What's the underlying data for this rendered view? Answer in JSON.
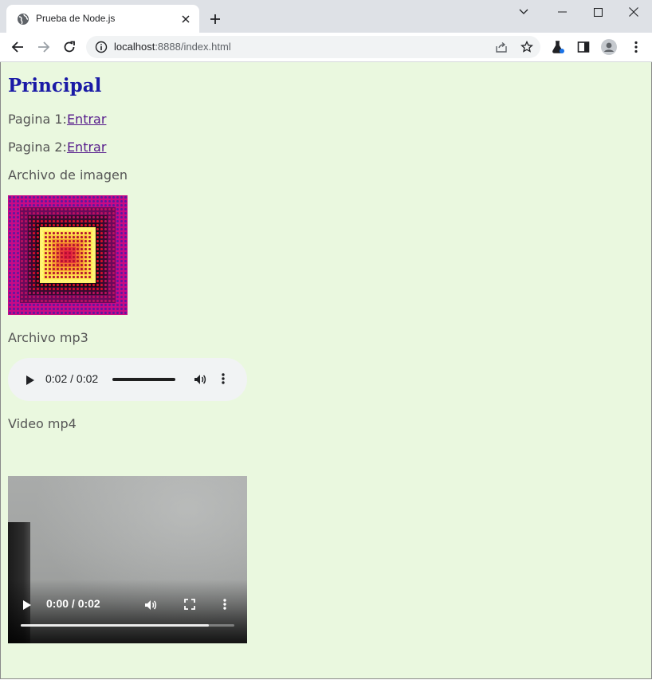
{
  "browser": {
    "tab_title": "Prueba de Node.js",
    "url_host": "localhost",
    "url_path": ":8888/index.html"
  },
  "page": {
    "title": "Principal",
    "link1_label": "Pagina 1:",
    "link1_text": "Entrar",
    "link2_label": "Pagina 2:",
    "link2_text": "Entrar",
    "image_label": "Archivo de imagen",
    "audio_label": "Archivo mp3",
    "video_label": "Video mp4"
  },
  "audio_player": {
    "time": "0:02 / 0:02",
    "progress": 1.0
  },
  "video_player": {
    "time": "0:00 / 0:02",
    "progress": 0.88
  },
  "colors": {
    "page_background": "#eaf8df",
    "title": "#1a1aa6",
    "visited_link": "#551a8b",
    "text": "#555555"
  }
}
